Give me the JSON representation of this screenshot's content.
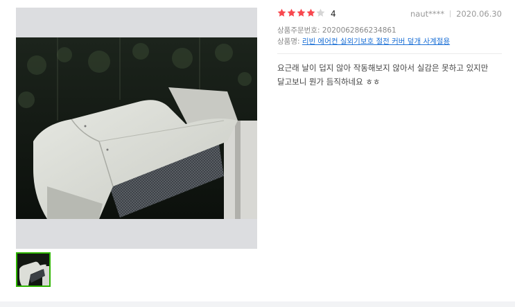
{
  "review": {
    "rating": 4,
    "rating_max": 5,
    "rating_text": "4",
    "author": "naut****",
    "date": "2020.06.30",
    "order_number_label": "상품주문번호:",
    "order_number": "2020062866234861",
    "product_label": "상품명:",
    "product_name": "리빈 에어컨 실외기보호 절전 커버 덮개 사계절용",
    "content": "요근래 날이 덥지 않아 작동해보지 않아서 실감은 못하고 있지만 달고보니 뭔가 듬직하네요 ㅎㅎ"
  },
  "colors": {
    "star_filled": "#f8484f",
    "star_empty": "#d6d6d6",
    "link": "#1a6fd6",
    "thumb_border": "#2db400"
  },
  "icons": {
    "star": "star-icon"
  }
}
